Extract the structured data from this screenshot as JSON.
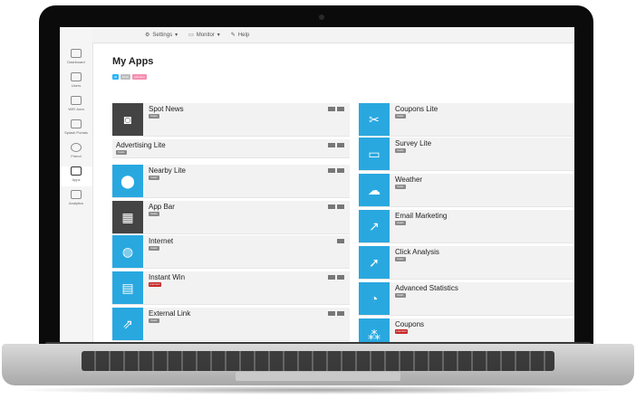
{
  "nav": {
    "items": [
      {
        "label": "Settings",
        "icon": "gear-icon"
      },
      {
        "label": "Monitor",
        "icon": "monitor-icon"
      },
      {
        "label": "Help",
        "icon": "help-icon"
      }
    ]
  },
  "sidebar": {
    "items": [
      {
        "label": "Dashboard",
        "icon": "dashboard-icon",
        "active": false
      },
      {
        "label": "Users",
        "icon": "users-icon",
        "active": false
      },
      {
        "label": "WiFi Area",
        "icon": "wifi-icon",
        "active": false
      },
      {
        "label": "Splash Portals",
        "icon": "portal-icon",
        "active": false
      },
      {
        "label": "Friend",
        "icon": "friend-icon",
        "active": false
      },
      {
        "label": "Apps",
        "icon": "apps-icon",
        "active": true
      },
      {
        "label": "Analytics",
        "icon": "analytics-icon",
        "active": false
      }
    ]
  },
  "page": {
    "title": "My Apps",
    "tags": [
      {
        "label": "all",
        "color": "#29b6f6"
      },
      {
        "label": "basic",
        "color": "#bdbdbd"
      },
      {
        "label": "premium",
        "color": "#f48fb1"
      }
    ]
  },
  "left_apps": [
    {
      "name": "Spot News",
      "badge": "basic",
      "icon": "rss-icon",
      "icon_color": "#444444"
    },
    {
      "name": "Advertising Lite",
      "badge": "basic",
      "icon": "",
      "icon_color": ""
    },
    {
      "name": "Nearby Lite",
      "badge": "basic",
      "icon": "location-pin-icon",
      "icon_color": "#29a8e0"
    },
    {
      "name": "App Bar",
      "badge": "basic",
      "icon": "grid-icon",
      "icon_color": "#444444"
    },
    {
      "name": "Internet",
      "badge": "basic",
      "icon": "globe-icon",
      "icon_color": "#29a8e0"
    },
    {
      "name": "Instant Win",
      "badge": "premium",
      "icon": "window-icon",
      "icon_color": "#29a8e0"
    },
    {
      "name": "External Link",
      "badge": "basic",
      "icon": "external-link-icon",
      "icon_color": "#29a8e0"
    }
  ],
  "right_apps": [
    {
      "name": "Coupons Lite",
      "badge": "basic",
      "icon": "coupon-icon",
      "icon_color": "#29a8e0"
    },
    {
      "name": "Survey Lite",
      "badge": "basic",
      "icon": "chat-icon",
      "icon_color": "#29a8e0"
    },
    {
      "name": "Weather",
      "badge": "basic",
      "icon": "cloud-icon",
      "icon_color": "#29a8e0"
    },
    {
      "name": "Email Marketing",
      "badge": "basic",
      "icon": "chart-up-icon",
      "icon_color": "#29a8e0"
    },
    {
      "name": "Click Analysis",
      "badge": "basic",
      "icon": "cursor-icon",
      "icon_color": "#29a8e0"
    },
    {
      "name": "Advanced Statistics",
      "badge": "basic",
      "icon": "pie-chart-icon",
      "icon_color": "#29a8e0"
    },
    {
      "name": "Coupons",
      "badge": "premium",
      "icon": "scatter-icon",
      "icon_color": "#29a8e0"
    }
  ]
}
